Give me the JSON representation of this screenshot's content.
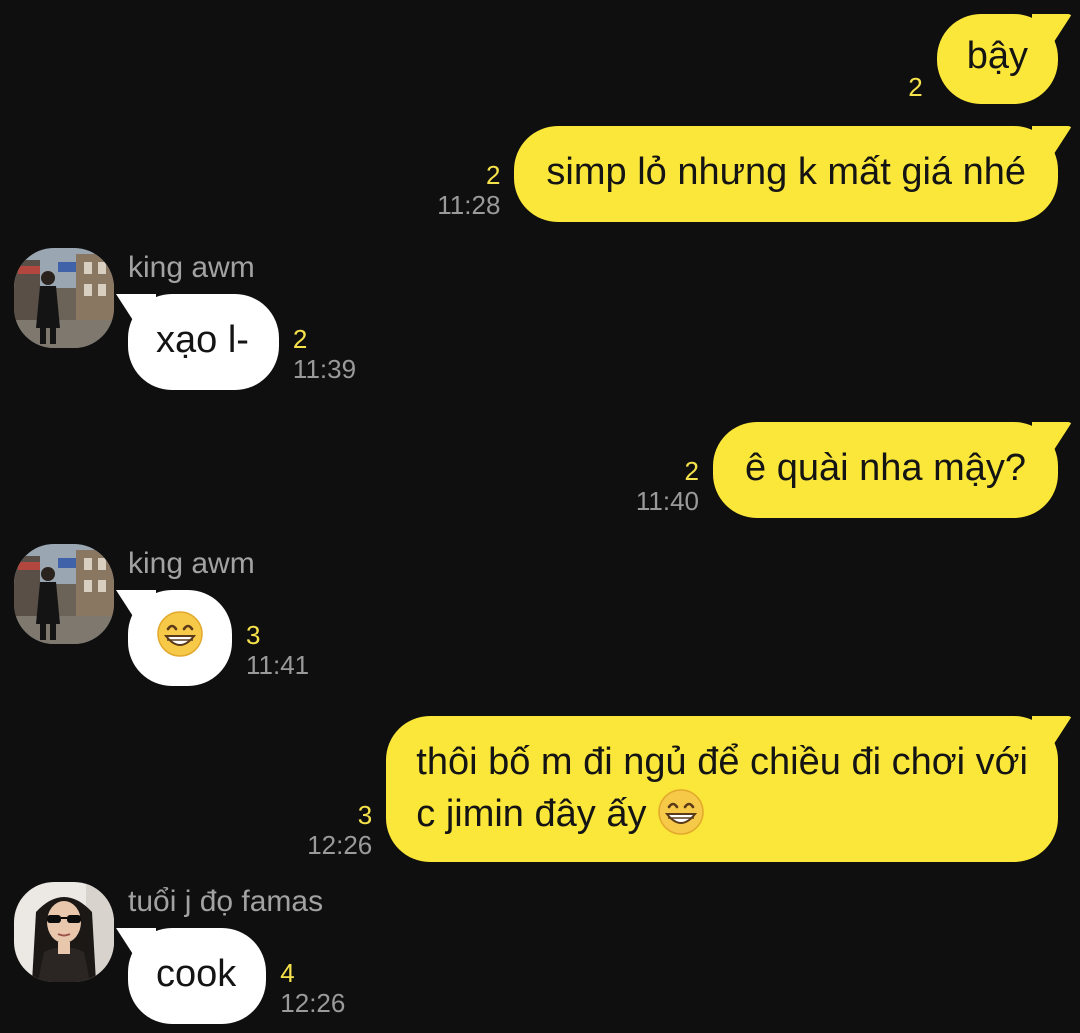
{
  "theme": {
    "background": "#0f0f10",
    "outgoing_bubble": "#fbe739",
    "incoming_bubble": "#ffffff",
    "unread_count_color": "#f6e24a",
    "time_color": "#9a9a9a"
  },
  "messages": [
    {
      "direction": "outgoing",
      "text": "bậy",
      "unread": "2",
      "time": ""
    },
    {
      "direction": "outgoing",
      "text": "simp lỏ nhưng k mất giá nhé",
      "unread": "2",
      "time": "11:28"
    },
    {
      "direction": "incoming",
      "sender": "king awm",
      "avatar_icon": "avatar-photo-man-street",
      "text": "xạo l-",
      "unread": "2",
      "time": "11:39"
    },
    {
      "direction": "outgoing",
      "text": "ê quài nha mậy?",
      "unread": "2",
      "time": "11:40"
    },
    {
      "direction": "incoming",
      "sender": "king awm",
      "avatar_icon": "avatar-photo-man-street",
      "emoji": "grinning-face-icon",
      "unread": "3",
      "time": "11:41"
    },
    {
      "direction": "outgoing",
      "line1": "thôi bố m đi ngủ để chiều đi chơi với",
      "line2": "c jimin đây ấy",
      "emoji": "grinning-face-icon",
      "unread": "3",
      "time": "12:26"
    },
    {
      "direction": "incoming",
      "sender": "tuổi j đọ famas",
      "avatar_icon": "avatar-photo-woman-sunglasses",
      "text": "cook",
      "unread": "4",
      "time": "12:26"
    }
  ]
}
